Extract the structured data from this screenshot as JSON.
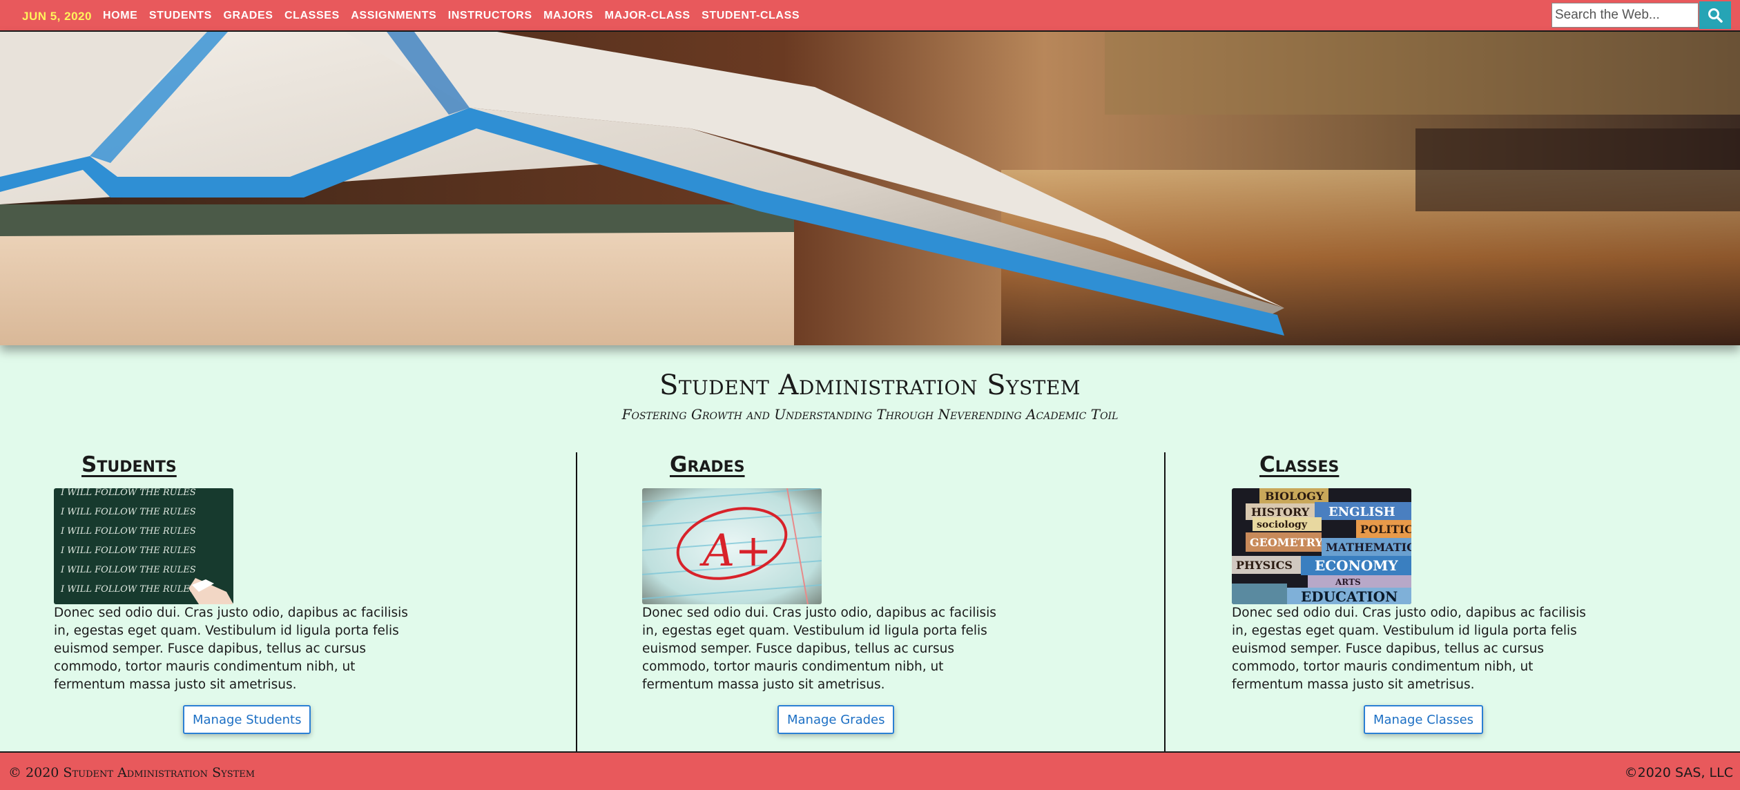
{
  "nav": {
    "date": "JUN 5, 2020",
    "links": [
      "HOME",
      "STUDENTS",
      "GRADES",
      "CLASSES",
      "ASSIGNMENTS",
      "INSTRUCTORS",
      "MAJORS",
      "MAJOR-CLASS",
      "STUDENT-CLASS"
    ],
    "search_placeholder": "Search the Web...",
    "search_icon": "search-icon"
  },
  "hero": {
    "image": "open-book-banner"
  },
  "header": {
    "title": "Student Administration System",
    "subtitle": "Fostering Growth and Understanding Through Neverending Academic Toil"
  },
  "sections": [
    {
      "heading": "Students",
      "image": "chalkboard-i-will-follow-the-rules",
      "image_lines": [
        "I WILL FOLLOW THE RULES",
        "I WILL FOLLOW THE RULES",
        "I WILL FOLLOW THE RULES",
        "I WILL FOLLOW THE RULES",
        "I WILL FOLLOW THE RULES",
        "I WILL FOLLOW THE RULES"
      ],
      "text": "Donec sed odio dui. Cras justo odio, dapibus ac facilisis in, egestas eget quam. Vestibulum id ligula porta felis euismod semper. Fusce dapibus, tellus ac cursus commodo, tortor mauris condimentum nibh, ut fermentum massa justo sit ametrisus.",
      "button": "Manage Students"
    },
    {
      "heading": "Grades",
      "image": "a-plus-grade-paper",
      "image_text": "A+",
      "text": "Donec sed odio dui. Cras justo odio, dapibus ac facilisis in, egestas eget quam. Vestibulum id ligula porta felis euismod semper. Fusce dapibus, tellus ac cursus commodo, tortor mauris condimentum nibh, ut fermentum massa justo sit ametrisus.",
      "button": "Manage Grades"
    },
    {
      "heading": "Classes",
      "image": "stack-of-subject-books",
      "image_words": [
        "BIOLOGY",
        "HISTORY",
        "ENGLISH",
        "sociology",
        "POLITIC",
        "GEOMETRY",
        "MATHEMATICS",
        "PHYSICS",
        "ECONOMY",
        "ARTS",
        "EDUCATION"
      ],
      "text": "Donec sed odio dui. Cras justo odio, dapibus ac facilisis in, egestas eget quam. Vestibulum id ligula porta felis euismod semper. Fusce dapibus, tellus ac cursus commodo, tortor mauris condimentum nibh, ut fermentum massa justo sit ametrisus.",
      "button": "Manage Classes"
    }
  ],
  "footer": {
    "left": "© 2020 Student Administration System",
    "right": "©2020 SAS, LLC"
  },
  "colors": {
    "nav_bg": "#e8595c",
    "date_color": "#fff45c",
    "page_bg": "#e1faeb",
    "search_button": "#26a4b5",
    "button_border": "#2a7fd4"
  }
}
